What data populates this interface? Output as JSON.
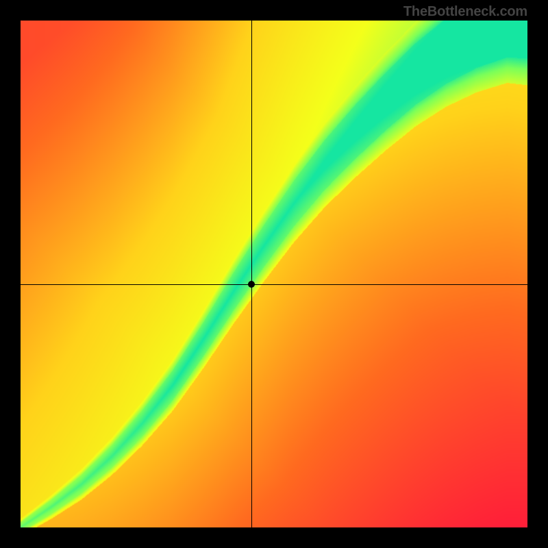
{
  "watermark": "TheBottleneck.com",
  "chart_data": {
    "type": "heatmap",
    "title": "",
    "xlabel": "",
    "ylabel": "",
    "xlim": [
      0,
      1
    ],
    "ylim": [
      0,
      1
    ],
    "grid_resolution": 200,
    "colormap": {
      "stops": [
        {
          "t": 0.0,
          "hex": "#ff1a3a"
        },
        {
          "t": 0.25,
          "hex": "#ff6a1f"
        },
        {
          "t": 0.5,
          "hex": "#ffd21a"
        },
        {
          "t": 0.72,
          "hex": "#f4ff1a"
        },
        {
          "t": 0.9,
          "hex": "#7aff5a"
        },
        {
          "t": 1.0,
          "hex": "#15e6a1"
        }
      ]
    },
    "optimal_ridge": {
      "comment": "S-curve of optimal match locus; fraction coords, y from bottom",
      "samples": [
        {
          "x": 0.0,
          "y": 0.0
        },
        {
          "x": 0.06,
          "y": 0.04
        },
        {
          "x": 0.12,
          "y": 0.085
        },
        {
          "x": 0.18,
          "y": 0.14
        },
        {
          "x": 0.24,
          "y": 0.205
        },
        {
          "x": 0.3,
          "y": 0.28
        },
        {
          "x": 0.36,
          "y": 0.37
        },
        {
          "x": 0.42,
          "y": 0.465
        },
        {
          "x": 0.48,
          "y": 0.555
        },
        {
          "x": 0.54,
          "y": 0.64
        },
        {
          "x": 0.6,
          "y": 0.715
        },
        {
          "x": 0.66,
          "y": 0.78
        },
        {
          "x": 0.72,
          "y": 0.84
        },
        {
          "x": 0.78,
          "y": 0.895
        },
        {
          "x": 0.84,
          "y": 0.94
        },
        {
          "x": 0.9,
          "y": 0.975
        },
        {
          "x": 0.96,
          "y": 1.0
        }
      ],
      "half_width_at_x0": 0.01,
      "half_width_at_x1": 0.075,
      "yellow_halo_factor": 1.7
    },
    "background_gradient": {
      "lower_triangle_color_bias": "red",
      "upper_triangle_color_bias": "yellow"
    },
    "crosshair": {
      "x": 0.455,
      "y": 0.48
    },
    "marker": {
      "x": 0.455,
      "y": 0.48
    }
  }
}
